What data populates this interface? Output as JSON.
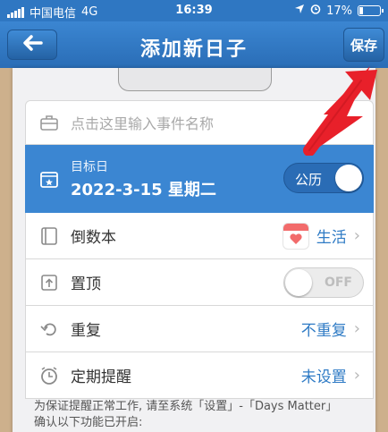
{
  "status_bar": {
    "carrier": "中国电信",
    "network": "4G",
    "time": "16:39",
    "battery": "17%",
    "battery_level": 0.17
  },
  "nav": {
    "title": "添加新日子",
    "save_label": "保存"
  },
  "form": {
    "event_name_placeholder": "点击这里输入事件名称",
    "target_day": {
      "label": "目标日",
      "date": "2022-3-15 星期二",
      "calendar_toggle_label": "公历"
    },
    "countdown_book": {
      "label": "倒数本",
      "value": "生活"
    },
    "pin_top": {
      "label": "置顶",
      "toggle_label": "OFF"
    },
    "repeat": {
      "label": "重复",
      "value": "不重复"
    },
    "reminder": {
      "label": "定期提醒",
      "value": "未设置"
    }
  },
  "note": "为保证提醒正常工作, 请至系统「设置」-「Days Matter」确认以下功能已开启:",
  "colors": {
    "accent": "#3b86d2",
    "highlight_arrow": "#e8202a",
    "value_text": "#2f7bc5"
  }
}
